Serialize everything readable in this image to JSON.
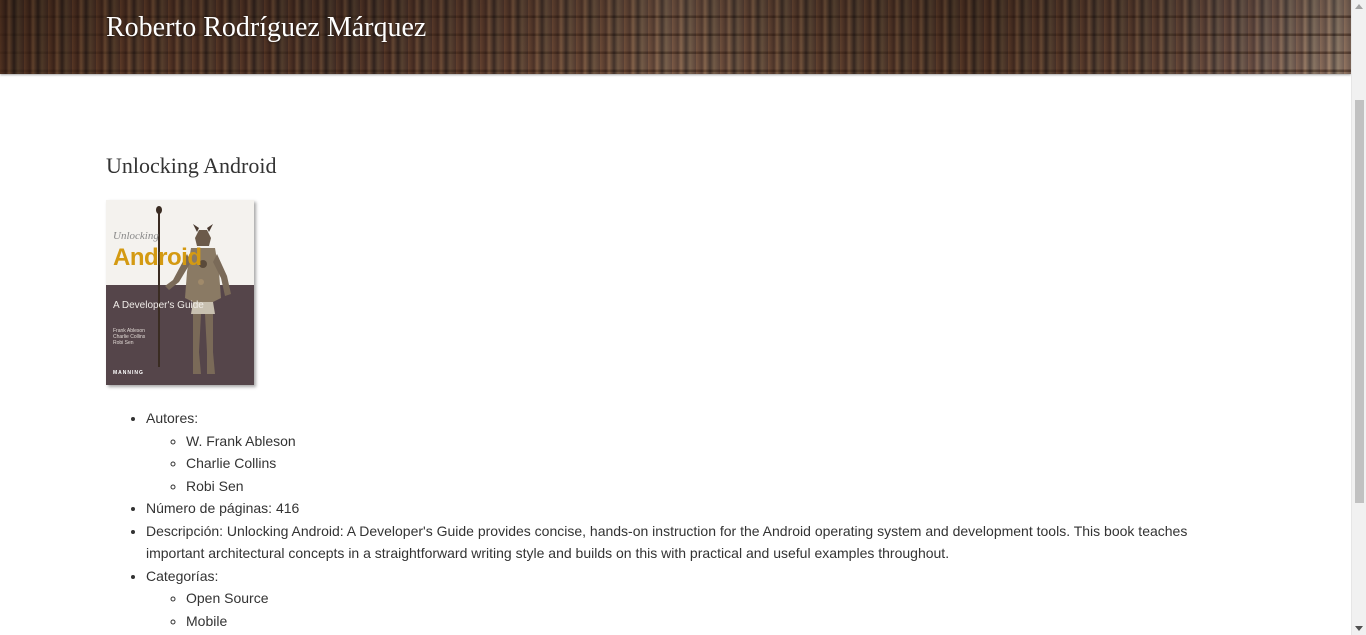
{
  "header": {
    "site_title": "Roberto Rodríguez Márquez"
  },
  "book": {
    "title": "Unlocking Android",
    "cover": {
      "top_line": "Unlocking",
      "main_title": "Android",
      "subtitle": "A Developer's Guide",
      "authors": [
        "Frank Ableson",
        "Charlie Collins",
        "Robi Sen"
      ],
      "publisher": "MANNING"
    },
    "authors_label": "Autores:",
    "authors": [
      "W. Frank Ableson",
      "Charlie Collins",
      "Robi Sen"
    ],
    "pages_text": "Número de páginas: 416",
    "description_text": "Descripción: Unlocking Android: A Developer's Guide provides concise, hands-on instruction for the Android operating system and development tools. This book teaches important architectural concepts in a straightforward writing style and builds on this with practical and useful examples throughout.",
    "categories_label": "Categorías:",
    "categories": [
      "Open Source",
      "Mobile"
    ]
  },
  "colors": {
    "text": "#333333",
    "cover_accent": "#d49a12",
    "cover_dark": "#55454a"
  }
}
